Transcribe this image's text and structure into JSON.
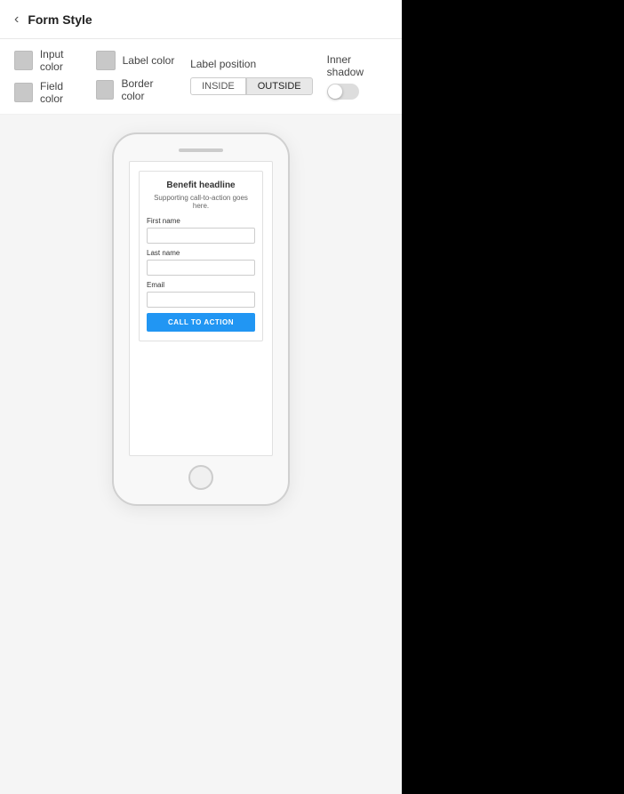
{
  "header": {
    "back_label": "Form Style",
    "back_arrow": "‹"
  },
  "toolbar": {
    "input_color_label": "Input color",
    "label_color_label": "Label color",
    "field_color_label": "Field color",
    "border_color_label": "Border color",
    "label_position_title": "Label position",
    "inside_label": "INSIDE",
    "outside_label": "OUTSIDE",
    "inner_shadow_title": "Inner shadow",
    "toggle_state": "off"
  },
  "phone": {
    "benefit_headline": "Benefit headline",
    "benefit_sub": "Supporting call-to-action goes here.",
    "first_name_label": "First name",
    "last_name_label": "Last name",
    "email_label": "Email",
    "cta_button_label": "CALL TO ACTION"
  }
}
